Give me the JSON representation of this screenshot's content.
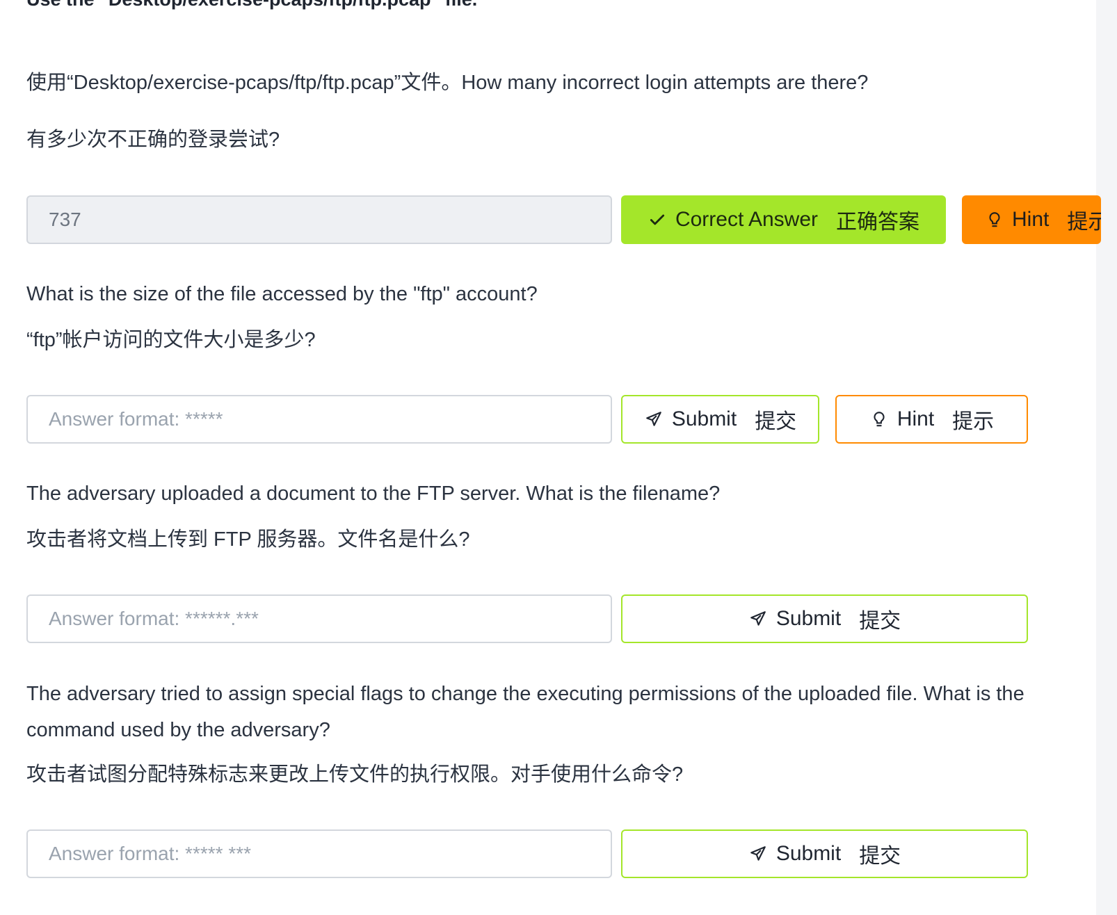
{
  "heading_cut": "Use the \"Desktop/exercise-pcaps/ftp/ftp.pcap\" file.",
  "questions": [
    {
      "text_en": "使用“Desktop/exercise-pcaps/ftp/ftp.pcap”文件。How many incorrect login attempts are there?",
      "text_zh": "有多少次不正确的登录尝试?",
      "answer_value": "737",
      "correct_label": "Correct Answer",
      "correct_label_zh": "正确答案",
      "hint_label": "Hint",
      "hint_label_zh": "提示"
    },
    {
      "text_en": "What is the size of the file accessed by the \"ftp\" account?",
      "text_zh": "“ftp”帐户访问的文件大小是多少?",
      "placeholder": "Answer format: *****",
      "submit_label": "Submit",
      "submit_label_zh": "提交",
      "hint_label": "Hint",
      "hint_label_zh": "提示"
    },
    {
      "text_en": "The adversary uploaded a document to the FTP server. What is the filename?",
      "text_zh": "攻击者将文档上传到 FTP 服务器。文件名是什么?",
      "placeholder": "Answer format: ******.***",
      "submit_label": "Submit",
      "submit_label_zh": "提交"
    },
    {
      "text_en": "The adversary tried to assign special flags to change the executing permissions of the uploaded file. What is the command used by the adversary?",
      "text_zh": "攻击者试图分配特殊标志来更改上传文件的执行权限。对手使用什么命令?",
      "placeholder": "Answer format: ***** ***",
      "submit_label": "Submit",
      "submit_label_zh": "提交"
    }
  ],
  "colors": {
    "accent_green": "#a4e62a",
    "accent_orange": "#ff8a00"
  },
  "icons": {
    "check": "check-icon",
    "hint": "lightbulb-icon",
    "submit": "send-icon"
  }
}
